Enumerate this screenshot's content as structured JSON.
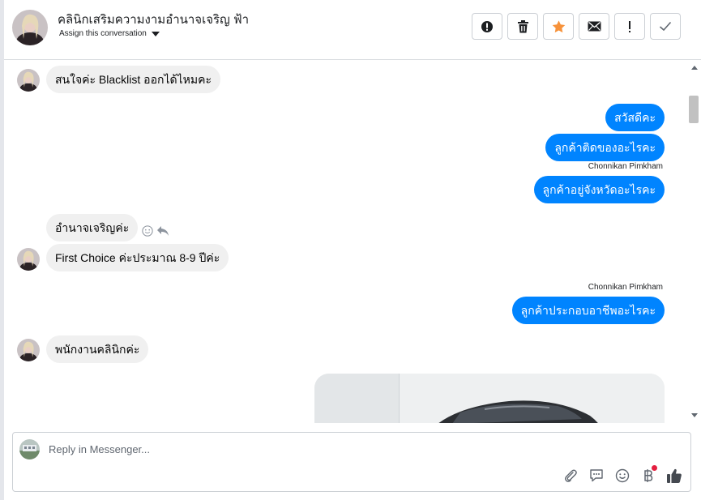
{
  "header": {
    "page_name": "คลินิกเสริมความงามอำนาจเจริญ ฟ้า",
    "assign_label": "Assign this conversation"
  },
  "actions": [
    {
      "name": "spam-button",
      "icon": "alert-circle-icon"
    },
    {
      "name": "delete-button",
      "icon": "trash-icon"
    },
    {
      "name": "star-button",
      "icon": "star-icon"
    },
    {
      "name": "mark-unread-button",
      "icon": "envelope-icon"
    },
    {
      "name": "follow-up-button",
      "icon": "exclamation-icon"
    },
    {
      "name": "done-button",
      "icon": "check-icon"
    }
  ],
  "colors": {
    "outgoing": "#0084ff",
    "incoming": "#f0f0f0",
    "star": "#f7923a"
  },
  "messages": [
    {
      "direction": "in",
      "text": "สนใจค่ะ Blacklist ออกได้ไหมคะ"
    },
    {
      "direction": "out",
      "text": "สวัสดีคะ"
    },
    {
      "direction": "out",
      "text": "ลูกค้าติดของอะไรคะ"
    },
    {
      "direction": "out",
      "sender": "Chonnikan Pimkham",
      "text": "ลูกค้าอยู่จังหวัดอะไรคะ"
    },
    {
      "direction": "in",
      "text": "อำนาจเจริญค่ะ"
    },
    {
      "direction": "in",
      "text": "First Choice ค่ะประมาณ 8-9 ปีค่ะ"
    },
    {
      "direction": "out",
      "sender": "Chonnikan Pimkham",
      "text": "ลูกค้าประกอบอาชีพอะไรคะ"
    },
    {
      "direction": "in",
      "text": "พนักงานคลินิกค่ะ"
    }
  ],
  "composer": {
    "placeholder": "Reply in Messenger...",
    "tools": [
      "paperclip-icon",
      "chat-bubble-icon",
      "smiley-icon",
      "baht-icon",
      "thumbs-up-icon"
    ]
  }
}
